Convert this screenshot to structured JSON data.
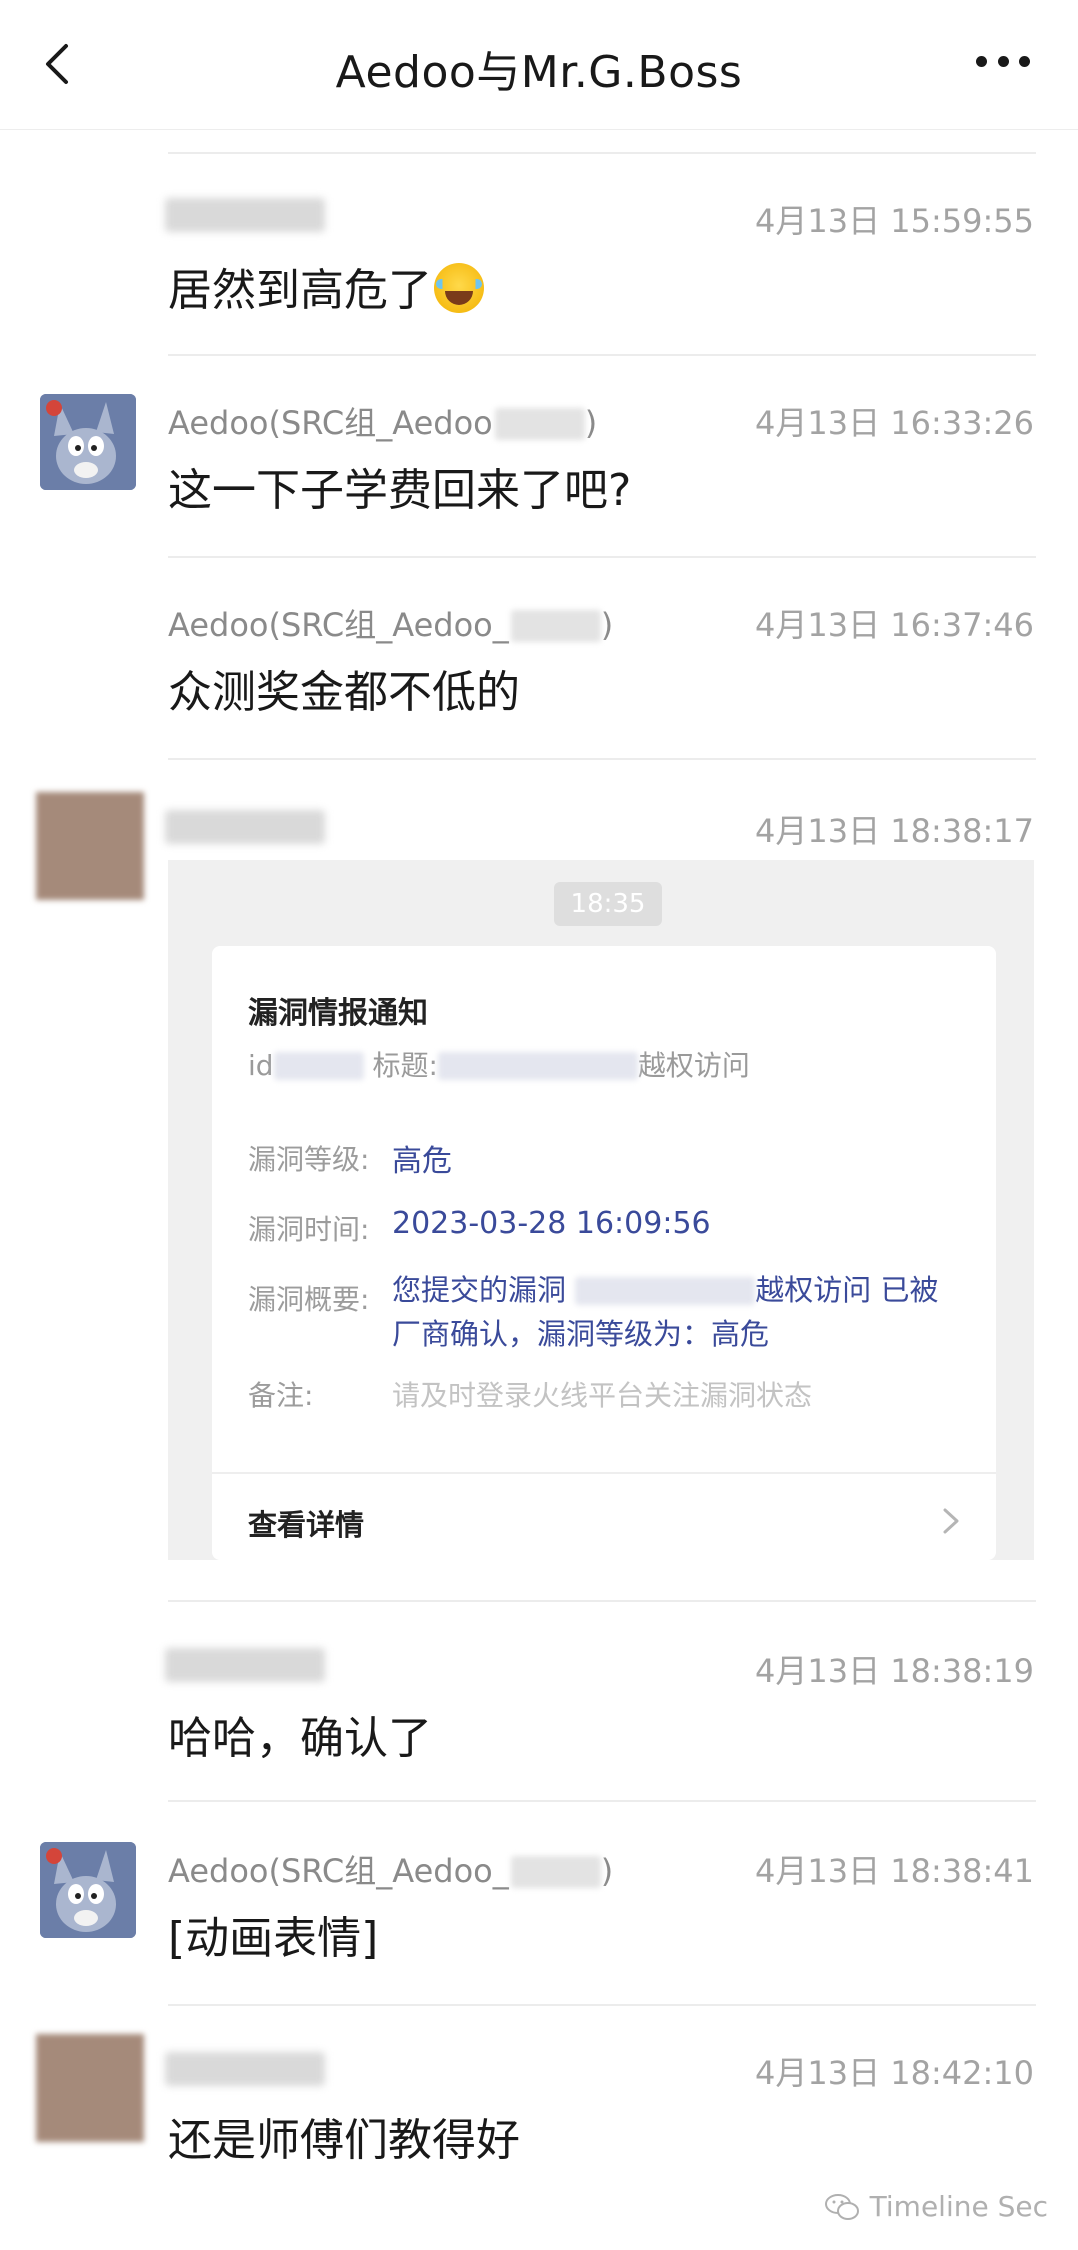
{
  "header": {
    "title": "Aedoo与Mr.G.Boss"
  },
  "messages": [
    {
      "sender": "",
      "time": "4月13日 15:59:55",
      "text": "居然到高危了"
    },
    {
      "sender": "Aedoo(SRC组_Aedoo",
      "sender_tail": ")",
      "time": "4月13日 16:33:26",
      "text": "这一下子学费回来了吧?"
    },
    {
      "sender": "Aedoo(SRC组_Aedoo_",
      "sender_tail": ")",
      "time": "4月13日 16:37:46",
      "text": "众测奖金都不低的"
    },
    {
      "sender": "",
      "time": "4月13日 18:38:17"
    },
    {
      "sender": "",
      "time": "4月13日 18:38:19",
      "text": "哈哈，确认了"
    },
    {
      "sender": "Aedoo(SRC组_Aedoo_",
      "sender_tail": ")",
      "time": "4月13日 18:38:41",
      "text": "[动画表情]"
    },
    {
      "sender": "",
      "time": "4月13日 18:42:10",
      "text": "还是师傅们教得好"
    }
  ],
  "card": {
    "time": "18:35",
    "title": "漏洞情报通知",
    "id_label": "id",
    "title_label": "标题:",
    "title_tail": "越权访问",
    "level_label": "漏洞等级:",
    "level_value": "高危",
    "time_label": "漏洞时间:",
    "time_value": "2023-03-28 16:09:56",
    "summary_label": "漏洞概要:",
    "summary_value_a": "您提交的漏洞",
    "summary_value_b": "越权访问 已被厂商确认，漏洞等级为：高危",
    "note_label": "备注:",
    "note_value": "请及时登录火线平台关注漏洞状态",
    "link_label": "查看详情"
  },
  "watermark": "Timeline Sec",
  "icons": [
    "back-arrow-icon",
    "more-icon",
    "chevron-right-icon",
    "wechat-icon",
    "laughing-emoji-icon"
  ]
}
